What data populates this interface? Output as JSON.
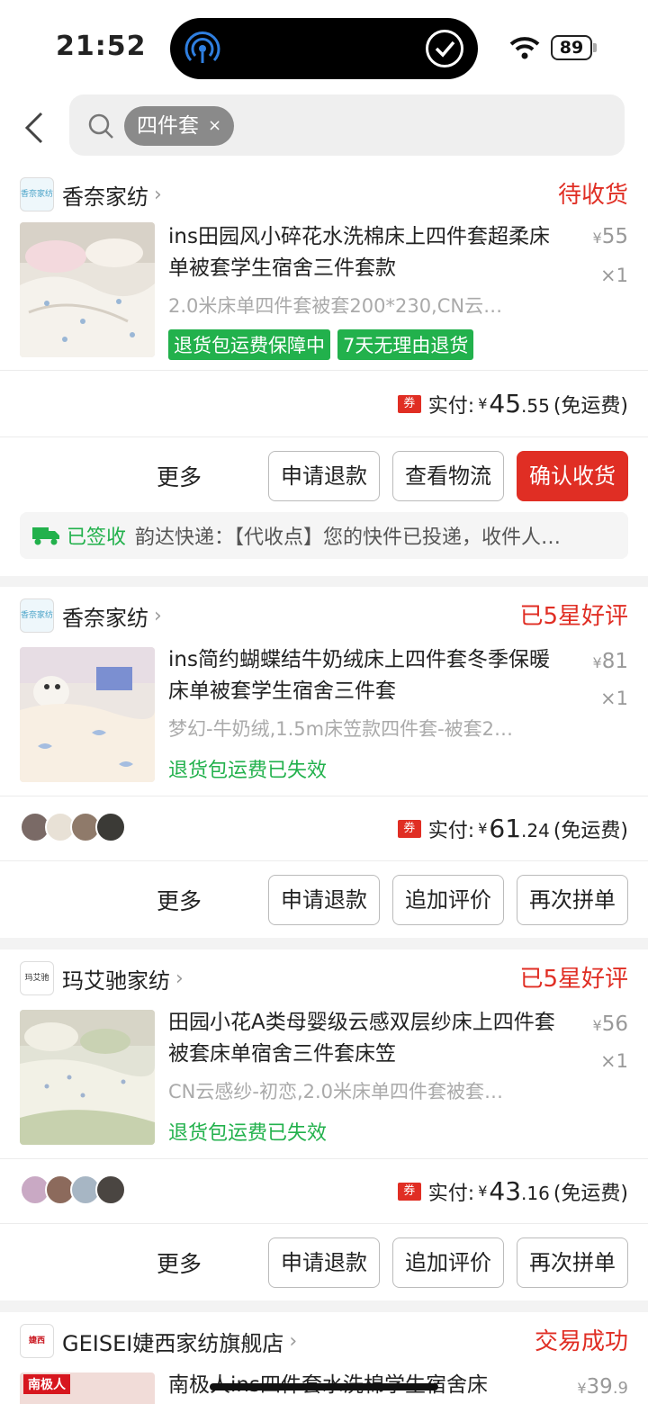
{
  "status_bar": {
    "time": "21:52",
    "battery": "89"
  },
  "search": {
    "chip": "四件套",
    "chip_close": "×"
  },
  "orders": [
    {
      "shop": "香奈家纺",
      "shop_logo_text": "香奈家纺",
      "status": "待收货",
      "title": "ins田园风小碎花水洗棉床上四件套超柔床单被套学生宿舍三件套款",
      "spec": "2.0米床单四件套被套200*230,CN云…",
      "tags": [
        "退货包运费保障中",
        "7天无理由退货"
      ],
      "price": "55",
      "qty": "×1",
      "pay_label": "实付:",
      "pay_int": "45",
      "pay_dec": ".55",
      "shipping": "(免运费)",
      "coupon": "券",
      "more": "更多",
      "buttons": [
        "申请退款",
        "查看物流",
        "确认收货"
      ],
      "logistics_status": "已签收",
      "logistics_text": "韵达快递：【代收点】您的快件已投递，收件人…"
    },
    {
      "shop": "香奈家纺",
      "shop_logo_text": "香奈家纺",
      "status": "已5星好评",
      "title": "ins简约蝴蝶结牛奶绒床上四件套冬季保暖床单被套学生宿舍三件套",
      "spec": "梦幻-牛奶绒,1.5m床笠款四件套-被套2…",
      "tag_text": "退货包运费已失效",
      "price": "81",
      "qty": "×1",
      "pay_label": "实付:",
      "pay_int": "61",
      "pay_dec": ".24",
      "shipping": "(免运费)",
      "coupon": "券",
      "more": "更多",
      "buttons": [
        "申请退款",
        "追加评价",
        "再次拼单"
      ]
    },
    {
      "shop": "玛艾驰家纺",
      "shop_logo_text": "玛艾驰",
      "status": "已5星好评",
      "title": "田园小花A类母婴级云感双层纱床上四件套被套床单宿舍三件套床笠",
      "spec": "CN云感纱-初恋,2.0米床单四件套被套…",
      "tag_text": "退货包运费已失效",
      "price": "56",
      "qty": "×1",
      "pay_label": "实付:",
      "pay_int": "43",
      "pay_dec": ".16",
      "shipping": "(免运费)",
      "coupon": "券",
      "more": "更多",
      "buttons": [
        "申请退款",
        "追加评价",
        "再次拼单"
      ]
    },
    {
      "shop": "GEISEI婕西家纺旗舰店",
      "shop_logo_text": "婕西",
      "status": "交易成功",
      "title": "南极人ins四件套水洗棉学生宿舍床",
      "thumb_text": "南极人",
      "price": "39",
      "price_dec": ".9"
    }
  ],
  "colors": {
    "accent_red": "#e02e24",
    "green": "#22b14c"
  }
}
